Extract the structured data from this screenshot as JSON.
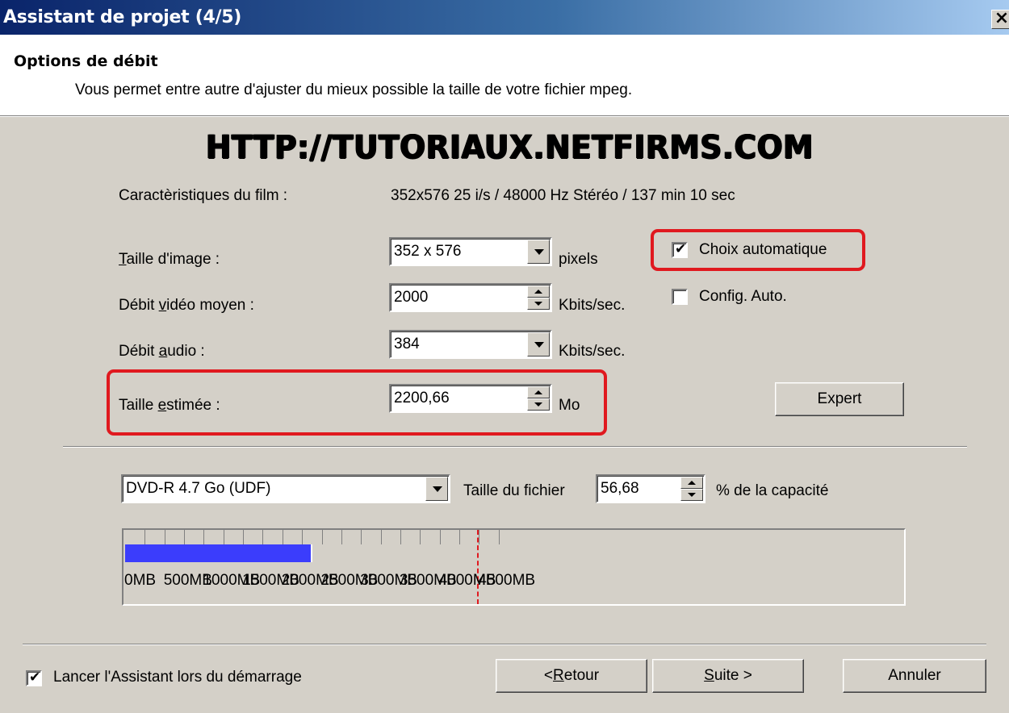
{
  "window": {
    "title": "Assistant de projet (4/5)",
    "close_glyph": "×"
  },
  "header": {
    "title": "Options de débit",
    "subtitle": "Vous permet entre autre d'ajuster du mieux possible la taille de votre fichier mpeg."
  },
  "watermark": "HTTP://TUTORIAUX.NETFIRMS.COM",
  "film": {
    "label": "Caractèristiques du film :",
    "value": "352x576 25 i/s / 48000 Hz Stéréo / 137 min 10 sec"
  },
  "image_size": {
    "label_first": "T",
    "label_rest": "aille d'image :",
    "value": "352 x 576",
    "unit": "pixels"
  },
  "video_bitrate": {
    "label_pre": "Débit ",
    "label_u": "v",
    "label_post": "idéo moyen :",
    "value": "2000",
    "unit": "Kbits/sec."
  },
  "audio_bitrate": {
    "label_pre": "Débit ",
    "label_u": "a",
    "label_post": "udio :",
    "value": "384",
    "unit": "Kbits/sec."
  },
  "estimated_size": {
    "label_pre": "Taille ",
    "label_u": "e",
    "label_post": "stimée :",
    "value": "2200,66",
    "unit": "Mo"
  },
  "auto_choice": {
    "label": "Choix automatique",
    "checked": true,
    "check_glyph": "✔"
  },
  "auto_config": {
    "label": "Config. Auto.",
    "checked": false
  },
  "expert_button": "Expert",
  "media": {
    "selected": "DVD-R 4.7 Go (UDF)",
    "file_size_label": "Taille du fichier",
    "file_size_value": "56,68",
    "capacity_label": "% de la capacité"
  },
  "gauge": {
    "max_mb": 5000,
    "fill_mb": 2380,
    "limit_mb": 4480,
    "labels": [
      "0MB",
      "500MB",
      "1000MB",
      "1500MB",
      "2000MB",
      "2500MB",
      "3000MB",
      "3500MB",
      "4000MB",
      "4500MB"
    ]
  },
  "startup": {
    "label": "Lancer l'Assistant lors du démarrage",
    "checked": true,
    "check_glyph": "✔"
  },
  "buttons": {
    "back_pre": "< ",
    "back_u": "R",
    "back_post": "etour",
    "next_u": "S",
    "next_post": "uite >",
    "cancel": "Annuler"
  },
  "colors": {
    "highlight": "#e0191f",
    "gauge_fill": "#3b3dfc",
    "title_bar": "#0a246a"
  }
}
